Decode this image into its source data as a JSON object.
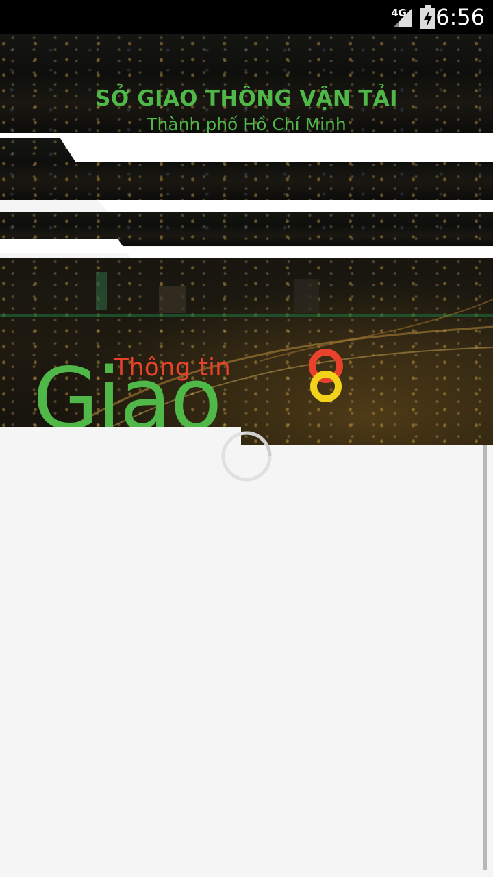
{
  "status_bar": {
    "network": "4G",
    "time": "6:56",
    "signal_icon": "signal-icon",
    "battery_icon": "battery-charging-icon"
  },
  "header": {
    "organization": "SỞ GIAO THÔNG VẬN TẢI",
    "city": "Thành phố Hồ Chí Minh"
  },
  "logo": {
    "tagline": "Thông tin",
    "brand": "Giao thônG",
    "colors": {
      "green": "#4fb848",
      "red": "#e8412c",
      "yellow": "#f2d21b"
    }
  },
  "loading": {
    "icon": "loading-spinner-icon"
  }
}
